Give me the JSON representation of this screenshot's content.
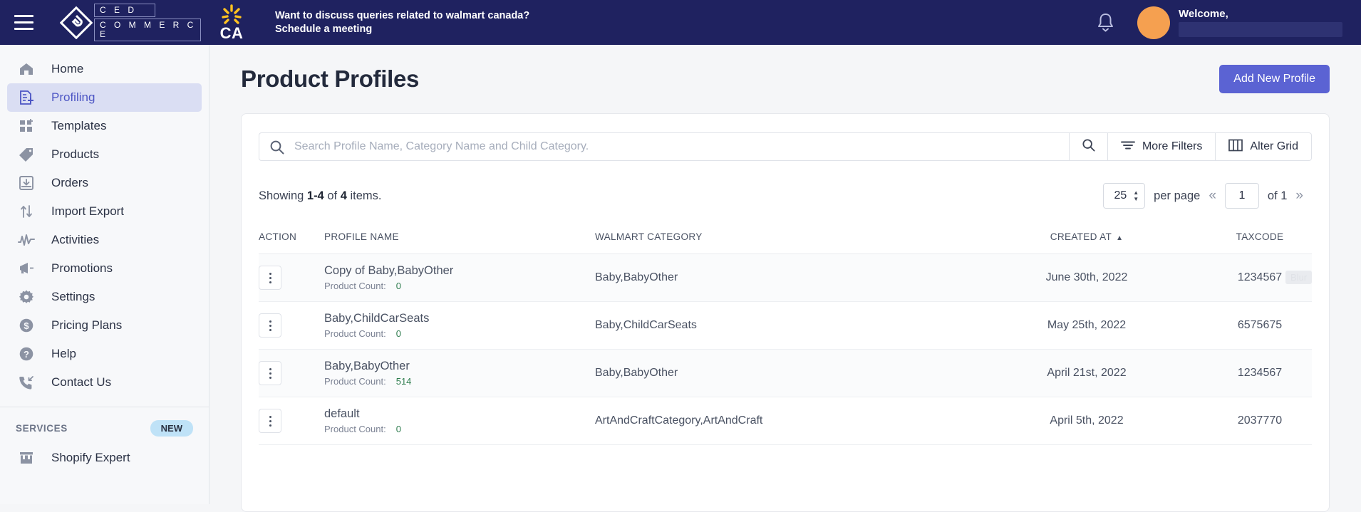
{
  "topbar": {
    "menu_icon": "hamburger-icon",
    "logo_line1": "C E D",
    "logo_line2": "C O M M E R C E",
    "marketplace": "CA",
    "banner_text": "Want to discuss queries related to walmart canada? ",
    "banner_link": "Schedule a meeting",
    "bell_icon": "bell-icon",
    "welcome_label": "Welcome,",
    "user_name": ""
  },
  "sidebar": {
    "items": [
      {
        "label": "Home",
        "icon": "home-icon",
        "active": false
      },
      {
        "label": "Profiling",
        "icon": "profiling-icon",
        "active": true
      },
      {
        "label": "Templates",
        "icon": "templates-icon",
        "active": false
      },
      {
        "label": "Products",
        "icon": "tag-icon",
        "active": false
      },
      {
        "label": "Orders",
        "icon": "orders-inbox-icon",
        "active": false
      },
      {
        "label": "Import Export",
        "icon": "import-export-icon",
        "active": false
      },
      {
        "label": "Activities",
        "icon": "activities-pulse-icon",
        "active": false
      },
      {
        "label": "Promotions",
        "icon": "megaphone-icon",
        "active": false
      },
      {
        "label": "Settings",
        "icon": "gear-icon",
        "active": false
      },
      {
        "label": "Pricing Plans",
        "icon": "dollar-circle-icon",
        "active": false
      },
      {
        "label": "Help",
        "icon": "question-circle-icon",
        "active": false
      },
      {
        "label": "Contact Us",
        "icon": "phone-incoming-icon",
        "active": false
      }
    ],
    "services_title": "SERVICES",
    "services_badge": "NEW",
    "services_items": [
      {
        "label": "Shopify Expert",
        "icon": "storefront-icon"
      }
    ]
  },
  "page": {
    "title": "Product Profiles",
    "add_button": "Add New Profile"
  },
  "search": {
    "placeholder": "Search Profile Name, Category Name and Child Category.",
    "value": "",
    "search_icon": "search-icon",
    "search_button_icon": "search-icon",
    "more_filters": "More Filters",
    "more_filters_icon": "filter-icon",
    "alter_grid": "Alter Grid",
    "alter_grid_icon": "columns-icon"
  },
  "pagination": {
    "showing_prefix": "Showing",
    "showing_range": "1-4",
    "showing_of": "of",
    "showing_total": "4",
    "showing_suffix": "items.",
    "per_page_value": "25",
    "per_page_label": "per page",
    "first_icon": "«",
    "last_icon": "»",
    "current_page": "1",
    "of_pages": "of 1"
  },
  "table": {
    "columns": [
      {
        "key": "action",
        "label": "ACTION"
      },
      {
        "key": "profile_name",
        "label": "PROFILE NAME"
      },
      {
        "key": "walmart_category",
        "label": "WALMART CATEGORY"
      },
      {
        "key": "created_at",
        "label": "CREATED AT",
        "sorted": "asc"
      },
      {
        "key": "taxcode",
        "label": "TAXCODE"
      }
    ],
    "product_count_label": "Product Count:",
    "rows": [
      {
        "profile_name": "Copy of Baby,BabyOther",
        "product_count": "0",
        "walmart_category": "Baby,BabyOther",
        "created_at": "June 30th, 2022",
        "taxcode": "1234567",
        "blur_chip": "Blur"
      },
      {
        "profile_name": "Baby,ChildCarSeats",
        "product_count": "0",
        "walmart_category": "Baby,ChildCarSeats",
        "created_at": "May 25th, 2022",
        "taxcode": "6575675",
        "blur_chip": ""
      },
      {
        "profile_name": "Baby,BabyOther",
        "product_count": "514",
        "walmart_category": "Baby,BabyOther",
        "created_at": "April 21st, 2022",
        "taxcode": "1234567",
        "blur_chip": ""
      },
      {
        "profile_name": "default",
        "product_count": "0",
        "walmart_category": "ArtAndCraftCategory,ArtAndCraft",
        "created_at": "April 5th, 2022",
        "taxcode": "2037770",
        "blur_chip": ""
      }
    ]
  },
  "colors": {
    "header_bg": "#1f2260",
    "accent": "#5b63d3",
    "active_nav_bg": "#dadef3",
    "avatar": "#f5a050",
    "badge_new_bg": "#bfe2f7",
    "count_green": "#2f7d4f",
    "walmart_yellow": "#ffc220"
  }
}
